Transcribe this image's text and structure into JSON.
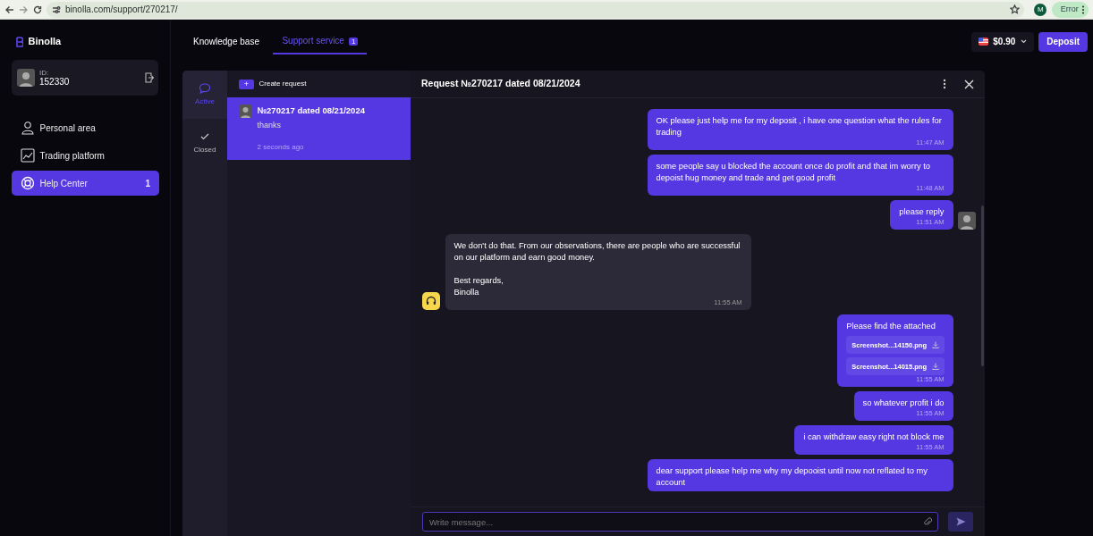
{
  "browser": {
    "url": "binolla.com/support/270217/",
    "profile": "M",
    "status": "Error"
  },
  "sidebar": {
    "logo": "Binolla",
    "user": {
      "id_label": "ID:",
      "id": "152330"
    },
    "items": [
      {
        "kind": "person",
        "label": "Personal area",
        "selected": false
      },
      {
        "kind": "chart",
        "label": "Trading platform",
        "selected": false
      },
      {
        "kind": "help",
        "label": "Help Center",
        "selected": true,
        "badge": "1"
      }
    ]
  },
  "tabs": [
    {
      "label": "Knowledge base",
      "selected": false
    },
    {
      "label": "Support service",
      "selected": true,
      "badge": "1"
    }
  ],
  "balance": {
    "amount": "$0.90"
  },
  "deposit_button": "Deposit",
  "filters": [
    {
      "kind": "chat",
      "label": "Active",
      "selected": true
    },
    {
      "kind": "check",
      "label": "Closed",
      "selected": false
    }
  ],
  "create_request": {
    "icon": "+",
    "label": "Create request"
  },
  "requests": [
    {
      "title": "№270217 dated 08/21/2024",
      "preview": "thanks",
      "time": "2 seconds ago",
      "selected": true
    }
  ],
  "chat": {
    "title": "Request №270217 dated 08/21/2024",
    "messages": [
      {
        "kind": "user",
        "text": "OK please just help me for my deposit , i have one question what the rules for trading",
        "time": "11:47 AM",
        "avatar": false
      },
      {
        "kind": "user",
        "text": "some people say u blocked the account once do profit and that im worry to depoist hug money and trade and get good profit",
        "time": "11:48 AM",
        "avatar": false
      },
      {
        "kind": "user",
        "text": "please reply",
        "time": "11:51 AM",
        "avatar": true
      },
      {
        "kind": "support",
        "text": "We don't do that. From our observations, there are people who are successful on our platform and earn good money.\n\nBest regards,\nBinolla",
        "time": "11:55 AM",
        "avatar": true
      },
      {
        "kind": "user",
        "text": "Please find the attached",
        "attachments": [
          "Screenshot...14150.png",
          "Screenshot...14015.png"
        ],
        "time": "11:55 AM",
        "avatar": false
      },
      {
        "kind": "user",
        "text": "so whatever profit i do",
        "time": "11:55 AM",
        "avatar": false
      },
      {
        "kind": "user",
        "text": "i can withdraw easy  right not block me",
        "time": "11:55 AM",
        "avatar": false
      },
      {
        "kind": "user",
        "text": "dear support please help me why my depooist until now not reflated to my account",
        "avatar": false
      }
    ],
    "input": {
      "placeholder": "Write message..."
    }
  }
}
